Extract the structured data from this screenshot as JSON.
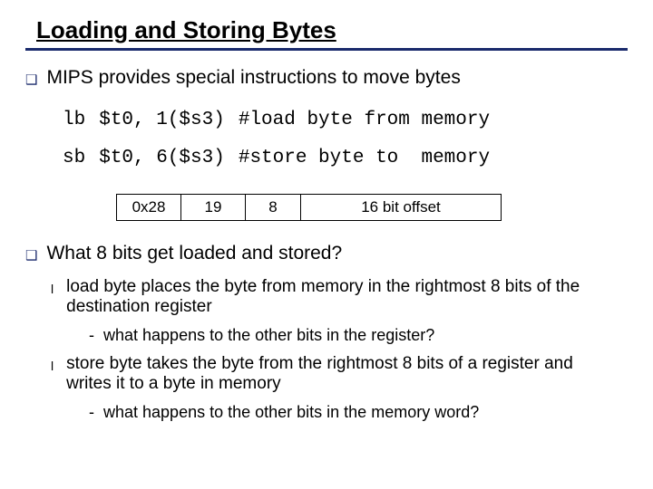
{
  "title": "Loading and Storing Bytes",
  "intro": "MIPS provides special instructions to move bytes",
  "code": {
    "row1": {
      "op": "lb",
      "args": "$t0, 1($s3)",
      "comment": "#load byte from memory"
    },
    "row2": {
      "op": "sb",
      "args": "$t0, 6($s3)",
      "comment": "#store byte to  memory"
    }
  },
  "encoding": {
    "f0": "0x28",
    "f1": "19",
    "f2": "8",
    "f3": "16 bit offset"
  },
  "question": "What 8 bits get loaded and stored?",
  "sub1": "load byte places the byte from memory in the rightmost 8 bits of the destination register",
  "sub1q": "what happens to the other bits in the register?",
  "sub2": "store byte takes the byte from the rightmost 8 bits of a register and writes it to a byte in memory",
  "sub2q": "what happens to the other bits in the memory word?"
}
